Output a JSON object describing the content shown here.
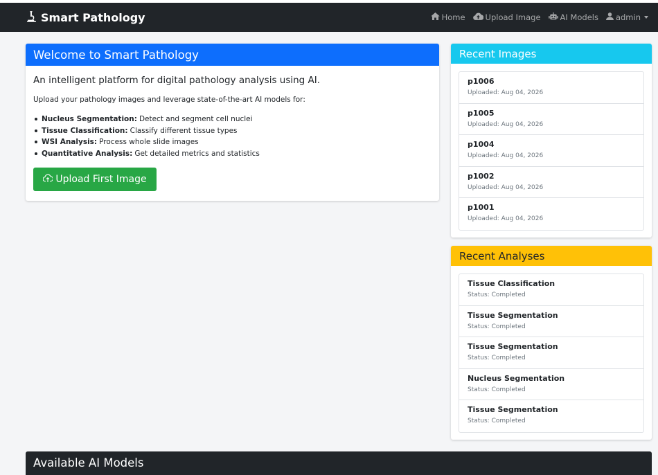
{
  "navbar": {
    "brand": "Smart Pathology",
    "links": [
      {
        "label": "Home",
        "icon": "home-icon"
      },
      {
        "label": "Upload Image",
        "icon": "cloud-upload-icon"
      },
      {
        "label": "AI Models",
        "icon": "robot-icon"
      },
      {
        "label": "admin",
        "icon": "user-icon"
      }
    ]
  },
  "welcome": {
    "title": "Welcome to Smart Pathology",
    "lead": "An intelligent platform for digital pathology analysis using AI.",
    "subtitle": "Upload your pathology images and leverage state-of-the-art AI models for:",
    "features": [
      {
        "name": "Nucleus Segmentation:",
        "desc": "Detect and segment cell nuclei"
      },
      {
        "name": "Tissue Classification:",
        "desc": "Classify different tissue types"
      },
      {
        "name": "WSI Analysis:",
        "desc": "Process whole slide images"
      },
      {
        "name": "Quantitative Analysis:",
        "desc": "Get detailed metrics and statistics"
      }
    ],
    "button_label": "Upload First Image"
  },
  "recent_images": {
    "title": "Recent Images",
    "items": [
      {
        "name": "p1006",
        "sub": "Uploaded: Aug 04, 2026"
      },
      {
        "name": "p1005",
        "sub": "Uploaded: Aug 04, 2026"
      },
      {
        "name": "p1004",
        "sub": "Uploaded: Aug 04, 2026"
      },
      {
        "name": "p1002",
        "sub": "Uploaded: Aug 04, 2026"
      },
      {
        "name": "p1001",
        "sub": "Uploaded: Aug 04, 2026"
      }
    ]
  },
  "recent_analyses": {
    "title": "Recent Analyses",
    "items": [
      {
        "name": "Tissue Classification",
        "sub": "Status: Completed"
      },
      {
        "name": "Tissue Segmentation",
        "sub": "Status: Completed"
      },
      {
        "name": "Tissue Segmentation",
        "sub": "Status: Completed"
      },
      {
        "name": "Nucleus Segmentation",
        "sub": "Status: Completed"
      },
      {
        "name": "Tissue Segmentation",
        "sub": "Status: Completed"
      }
    ]
  },
  "models": {
    "title": "Available AI Models"
  },
  "colors": {
    "navbar": "#212529",
    "primary": "#0d6efd",
    "info": "#17c8ee",
    "warning": "#ffc107",
    "success": "#28a745"
  }
}
